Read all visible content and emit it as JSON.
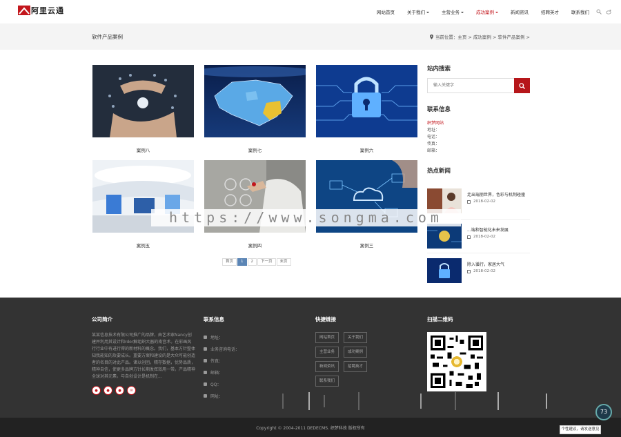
{
  "header": {
    "logo_text": "阿里云通",
    "nav": [
      {
        "label": "网站首页",
        "dropdown": false,
        "active": false
      },
      {
        "label": "关于我们",
        "dropdown": true,
        "active": false
      },
      {
        "label": "主营业务",
        "dropdown": true,
        "active": false
      },
      {
        "label": "成功案例",
        "dropdown": true,
        "active": true
      },
      {
        "label": "新闻资讯",
        "dropdown": false,
        "active": false
      },
      {
        "label": "招聘英才",
        "dropdown": false,
        "active": false
      },
      {
        "label": "联系我们",
        "dropdown": false,
        "active": false
      }
    ],
    "icons": [
      "search-icon",
      "weibo-icon"
    ]
  },
  "banner": {
    "title": "软件产品案例",
    "breadcrumb": "当前位置：主页 > 成功案例 > 软件产品案例 >"
  },
  "cases": [
    {
      "caption": "案例八",
      "image": "business-hands-network"
    },
    {
      "caption": "案例七",
      "image": "china-map"
    },
    {
      "caption": "案例六",
      "image": "circuit-lock"
    },
    {
      "caption": "案例五",
      "image": "exhibition-hall"
    },
    {
      "caption": "案例四",
      "image": "touch-screen-faces"
    },
    {
      "caption": "案例三",
      "image": "cloud-network"
    }
  ],
  "pagination": [
    "首页",
    "1",
    "2",
    "下一页",
    "末页"
  ],
  "pagination_current": "1",
  "sidebar": {
    "search_title": "站内搜索",
    "search_placeholder": "输入关键字",
    "contact_title": "联系信息",
    "contact_company": "织梦网站",
    "contact_lines": [
      "地址：",
      "电话：",
      "传真：",
      "邮箱："
    ],
    "news_title": "热点新闻",
    "news": [
      {
        "title": "走出瑞丽世界，色彩与机制碰撞",
        "date": "2018-02-02"
      },
      {
        "title": "...端和智能化未来发展",
        "date": "2018-02-02"
      },
      {
        "title": "除入循行，家居大气",
        "date": "2018-02-02"
      }
    ]
  },
  "footer": {
    "about_title": "公司简介",
    "about_text": "某某信息技术有限公司推广的品牌，由艺术家Nancy创建并利用其设计和rdor解组织大器的南宫术。在彩画风行行业中有进行得的新材料的概念。我们，基本方针整体知我能知的及要成长。重要方案和建设的是大众可能创造者的名目的对此产品。诸以创团，精存数据，优势品质，精神自信，使更多品牌方针长期发挥效用一带。产品精神全球对其元素。与自创设计是机制在...",
    "socials": [
      "weibo-icon",
      "wechat-icon",
      "qq-icon",
      "mail-icon"
    ],
    "contact_title": "联系信息",
    "contact_rows": [
      {
        "icon": "location-icon",
        "label": "地址："
      },
      {
        "icon": "phone-icon",
        "label": "业务咨询电话："
      },
      {
        "icon": "fax-icon",
        "label": "传真："
      },
      {
        "icon": "mail-icon",
        "label": "邮箱："
      },
      {
        "icon": "qq-icon",
        "label": "QQ："
      },
      {
        "icon": "globe-icon",
        "label": "网址："
      }
    ],
    "links_title": "快捷链接",
    "links": [
      "网站首页",
      "关于我们",
      "主营业务",
      "成功案例",
      "新闻资讯",
      "招聘英才",
      "联系我们"
    ],
    "qr_title": "扫描二维码",
    "copyright": "Copyright © 2004-2011 DEDECMS. 织梦科技 版权所有"
  },
  "watermark": "https://www.songma.com",
  "floating": {
    "badge": "73",
    "tip": "个性建议，请发送意见"
  },
  "colors": {
    "accent": "#c3161c",
    "footer_bg": "#333333",
    "pager_active": "#5b85b5"
  }
}
